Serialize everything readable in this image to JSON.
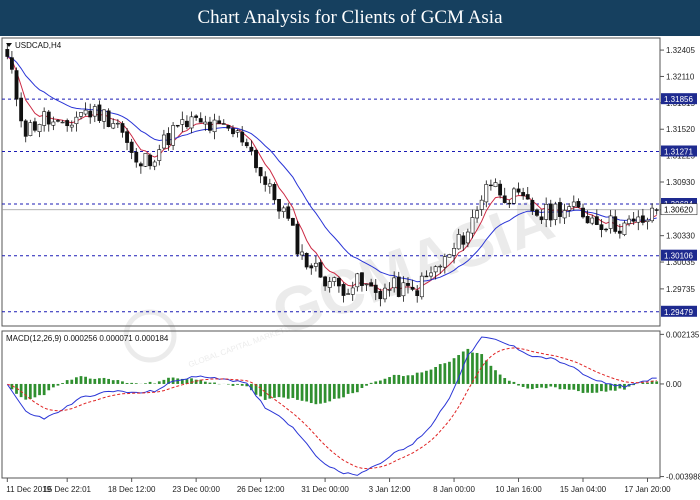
{
  "banner": {
    "title": "Chart Analysis for Clients of GCM Asia"
  },
  "chart_data": {
    "type": "candlestick",
    "title": "USDCAD,H4",
    "watermark": "GCMASIA",
    "watermark_sub": "GLOBAL CAPITAL MARKETS",
    "ylim": [
      1.2932,
      1.3254
    ],
    "y_ticks": [
      "1.32405",
      "1.32110",
      "1.31815",
      "1.31520",
      "1.31225",
      "1.30930",
      "1.30620",
      "1.30330",
      "1.30035",
      "1.29735"
    ],
    "y_tick_values": [
      1.32405,
      1.3211,
      1.31815,
      1.3152,
      1.31225,
      1.3093,
      1.3062,
      1.3033,
      1.30035,
      1.29735
    ],
    "x_ticks": [
      "11 Dec 2019",
      "15 Dec 22:01",
      "18 Dec 12:00",
      "23 Dec 00:00",
      "26 Dec 12:00",
      "31 Dec 00:00",
      "3 Jan 12:00",
      "8 Jan 00:00",
      "10 Jan 16:00",
      "15 Jan 04:00",
      "17 Jan 20:00"
    ],
    "x_tick_bars": [
      0,
      13,
      27,
      41,
      55,
      69,
      83,
      97,
      111,
      125,
      139
    ],
    "bar_count": 142,
    "levels": [
      {
        "label": "1.31856",
        "value": 1.31856,
        "color": "#1b1bb5"
      },
      {
        "label": "1.31271",
        "value": 1.31271,
        "color": "#1b1bb5"
      },
      {
        "label": "1.30684",
        "value": 1.30684,
        "color": "#1b1bb5"
      },
      {
        "label": "1.30106",
        "value": 1.30106,
        "color": "#1b1bb5"
      },
      {
        "label": "1.29479",
        "value": 1.29479,
        "color": "#1b1bb5"
      }
    ],
    "current_price": {
      "label": "1.30620",
      "value": 1.3062
    },
    "close_path": [
      [
        0,
        1.323
      ],
      [
        4,
        1.315
      ],
      [
        8,
        1.3165
      ],
      [
        12,
        1.315
      ],
      [
        16,
        1.3172
      ],
      [
        20,
        1.317
      ],
      [
        24,
        1.316
      ],
      [
        28,
        1.311
      ],
      [
        32,
        1.3125
      ],
      [
        36,
        1.315
      ],
      [
        40,
        1.316
      ],
      [
        44,
        1.3155
      ],
      [
        48,
        1.315
      ],
      [
        52,
        1.314
      ],
      [
        56,
        1.309
      ],
      [
        60,
        1.306
      ],
      [
        64,
        1.301
      ],
      [
        68,
        1.299
      ],
      [
        72,
        1.2975
      ],
      [
        76,
        1.298
      ],
      [
        80,
        1.297
      ],
      [
        84,
        1.2975
      ],
      [
        88,
        1.297
      ],
      [
        92,
        1.299
      ],
      [
        96,
        1.301
      ],
      [
        100,
        1.304
      ],
      [
        102,
        1.306
      ],
      [
        104,
        1.3095
      ],
      [
        108,
        1.308
      ],
      [
        112,
        1.307
      ],
      [
        116,
        1.3055
      ],
      [
        120,
        1.3065
      ],
      [
        124,
        1.306
      ],
      [
        128,
        1.305
      ],
      [
        132,
        1.3045
      ],
      [
        136,
        1.3045
      ],
      [
        140,
        1.3055
      ],
      [
        141,
        1.3062
      ]
    ],
    "ma_fast": {
      "color": "#cc2a44"
    },
    "ma_slow": {
      "color": "#2a35d6"
    },
    "macd": {
      "label": "MACD(12,26,9) 0.000256 0.000071 0.000184",
      "ylim": [
        -0.00405,
        0.00228
      ],
      "y_ticks": [
        "0.002135",
        "0.00",
        "-0.003988"
      ],
      "y_tick_values": [
        0.002135,
        0.0,
        -0.003988
      ],
      "macd_path": [
        [
          0,
          0.0
        ],
        [
          4,
          -0.0012
        ],
        [
          8,
          -0.0015
        ],
        [
          12,
          -0.0011
        ],
        [
          16,
          -0.0006
        ],
        [
          20,
          -0.0004
        ],
        [
          24,
          -0.0003
        ],
        [
          28,
          -0.0004
        ],
        [
          32,
          -0.0003
        ],
        [
          36,
          0.0001
        ],
        [
          40,
          0.0003
        ],
        [
          44,
          0.0003
        ],
        [
          48,
          0.0002
        ],
        [
          52,
          0.0
        ],
        [
          56,
          -0.001
        ],
        [
          60,
          -0.0015
        ],
        [
          64,
          -0.0023
        ],
        [
          68,
          -0.0033
        ],
        [
          72,
          -0.0038
        ],
        [
          76,
          -0.0039
        ],
        [
          80,
          -0.0035
        ],
        [
          84,
          -0.003
        ],
        [
          88,
          -0.0026
        ],
        [
          92,
          -0.0018
        ],
        [
          96,
          -0.0006
        ],
        [
          100,
          0.0012
        ],
        [
          103,
          0.002
        ],
        [
          106,
          0.0019
        ],
        [
          110,
          0.0016
        ],
        [
          114,
          0.0012
        ],
        [
          118,
          0.0011
        ],
        [
          122,
          0.0008
        ],
        [
          126,
          0.0003
        ],
        [
          130,
          0.0
        ],
        [
          134,
          -0.0001
        ],
        [
          138,
          0.0001
        ],
        [
          141,
          0.0003
        ]
      ],
      "signal_color": "#e02424",
      "macd_color": "#2a35d6",
      "hist_color": "#2f8f2f"
    }
  }
}
